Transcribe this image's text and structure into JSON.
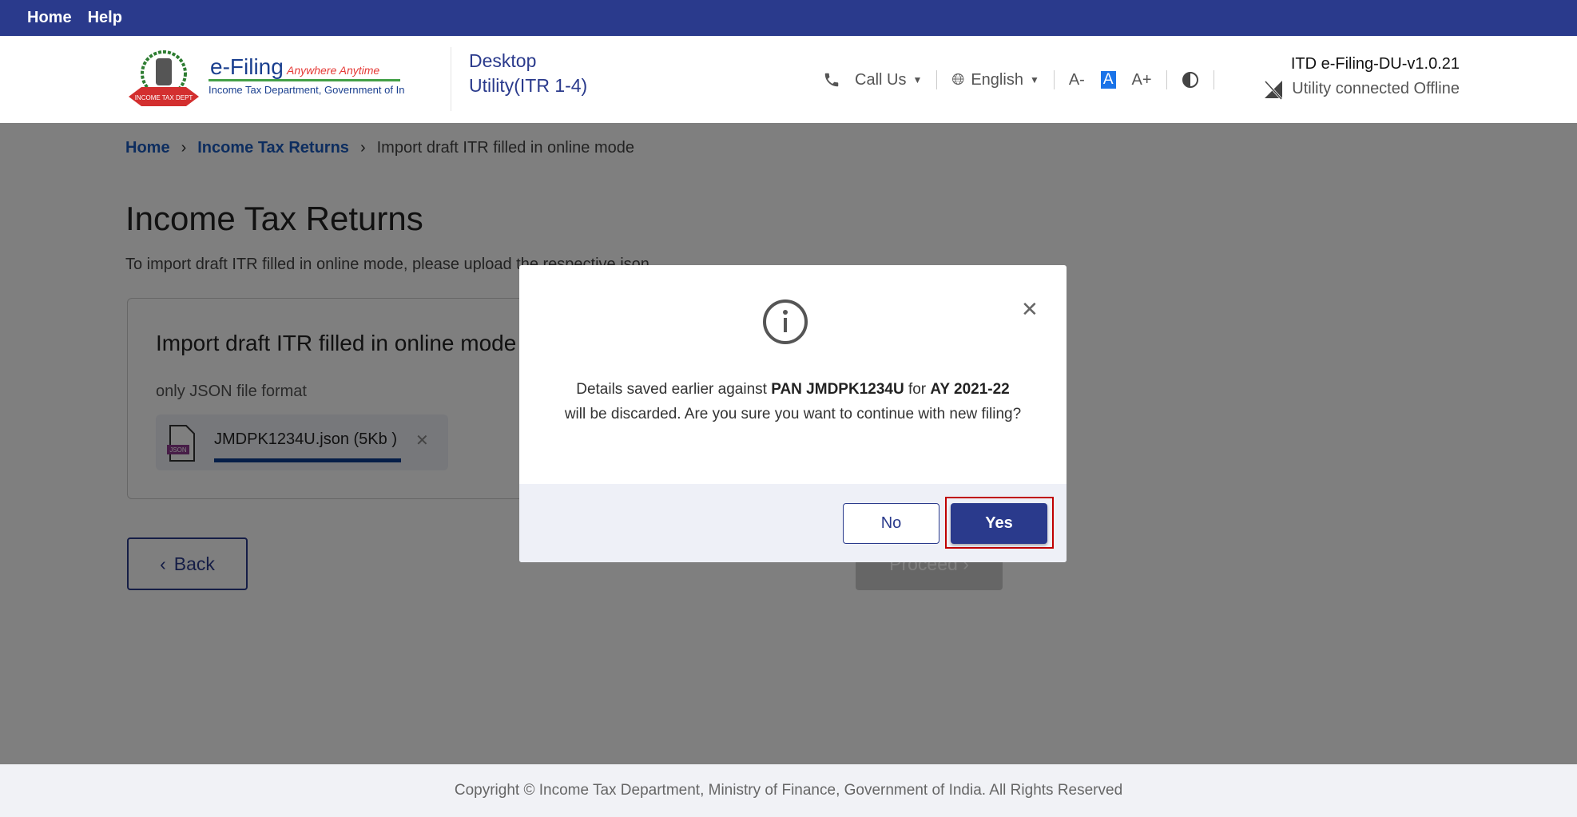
{
  "topnav": {
    "home": "Home",
    "help": "Help"
  },
  "header": {
    "logo": {
      "title": "e-Filing",
      "tagline": "Anywhere Anytime",
      "dept": "Income Tax Department, Government of India",
      "ribbon": "INCOME TAX DEPARTMENT"
    },
    "app_title_line1": "Desktop",
    "app_title_line2": "Utility(ITR 1-4)",
    "call_us": "Call Us",
    "language": "English",
    "font_decrease": "A-",
    "font_normal": "A",
    "font_increase": "A+",
    "version": "ITD e-Filing-DU-v1.0.21",
    "connection_status": "Utility connected Offline"
  },
  "breadcrumb": [
    "Home",
    "Income Tax Returns",
    "Import draft ITR filled in online mode"
  ],
  "page": {
    "title": "Income Tax Returns",
    "subtitle": "To import draft ITR filled in online mode, please upload the respective json",
    "card_title": "Import draft ITR filled in online mode",
    "format_note": "only JSON file format",
    "file_name": "JMDPK1234U.json (5Kb )",
    "file_type": "JSON",
    "upload_progress": 1.0,
    "back": "Back",
    "proceed": "Proceed"
  },
  "dialog": {
    "msg_prefix": "Details saved earlier against ",
    "pan": "PAN JMDPK1234U",
    "msg_mid": " for ",
    "ay": "AY 2021-22",
    "msg_line2": "will be discarded. Are you sure you want to continue with new filing?",
    "no": "No",
    "yes": "Yes"
  },
  "footer": "Copyright © Income Tax Department, Ministry of Finance, Government of India. All Rights Reserved",
  "colors": {
    "brand": "#2a3a8c",
    "highlight": "#c00000",
    "link": "#1b5bbf"
  }
}
